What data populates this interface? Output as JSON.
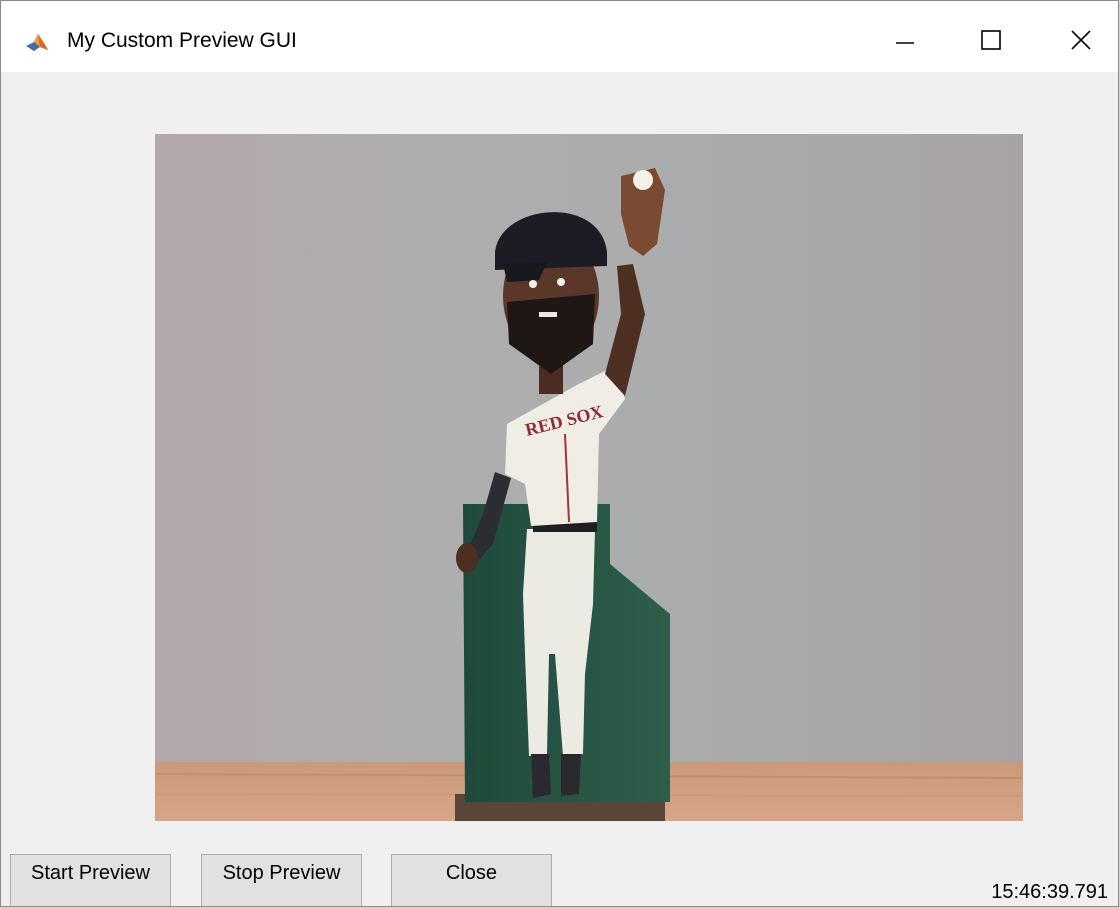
{
  "window": {
    "title": "My Custom Preview GUI",
    "app_icon": "matlab-logo-icon",
    "controls": {
      "minimize_icon": "minimize-icon",
      "maximize_icon": "maximize-icon",
      "close_icon": "close-icon"
    }
  },
  "buttons": {
    "start_preview": "Start Preview",
    "stop_preview": "Stop Preview",
    "close": "Close"
  },
  "timestamp": "15:46:39.791",
  "colors": {
    "window_background": "#f0f0f0",
    "titlebar_background": "#ffffff",
    "button_background": "#e1e1e1",
    "button_border": "#adadad"
  }
}
